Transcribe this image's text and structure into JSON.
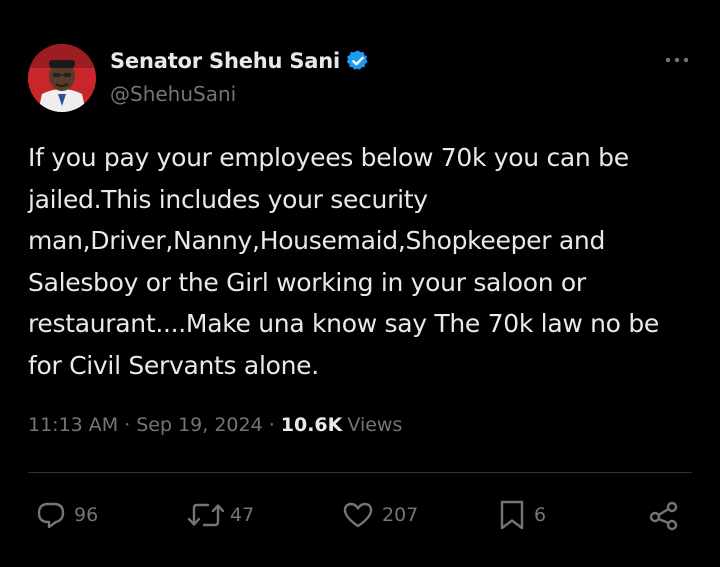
{
  "author": {
    "display_name": "Senator Shehu Sani",
    "handle": "@ShehuSani",
    "verified": true,
    "avatar_icon": "profile-photo-avatar"
  },
  "post": {
    "text": "If you pay your employees below 70k you can be jailed.This includes your security man,Driver,Nanny,Housemaid,Shopkeeper and Salesboy or the Girl working in your saloon or restaurant....Make una know say The 70k law no be  for Civil Servants alone.",
    "time": "11:13 AM",
    "date": "Sep 19, 2024",
    "separator": "·",
    "views_count": "10.6K",
    "views_label": "Views"
  },
  "actions": {
    "replies": "96",
    "reposts": "47",
    "likes": "207",
    "bookmarks": "6"
  },
  "icons": {
    "more": "more-horizontal-icon",
    "verified": "verified-badge-icon",
    "reply": "reply-icon",
    "repost": "repost-icon",
    "like": "heart-icon",
    "bookmark": "bookmark-icon",
    "share": "share-icon"
  },
  "colors": {
    "background": "#000000",
    "text_primary": "#e7e9ea",
    "text_secondary": "#71767b",
    "divider": "#2f3336",
    "verified_blue": "#1d9bf0"
  }
}
